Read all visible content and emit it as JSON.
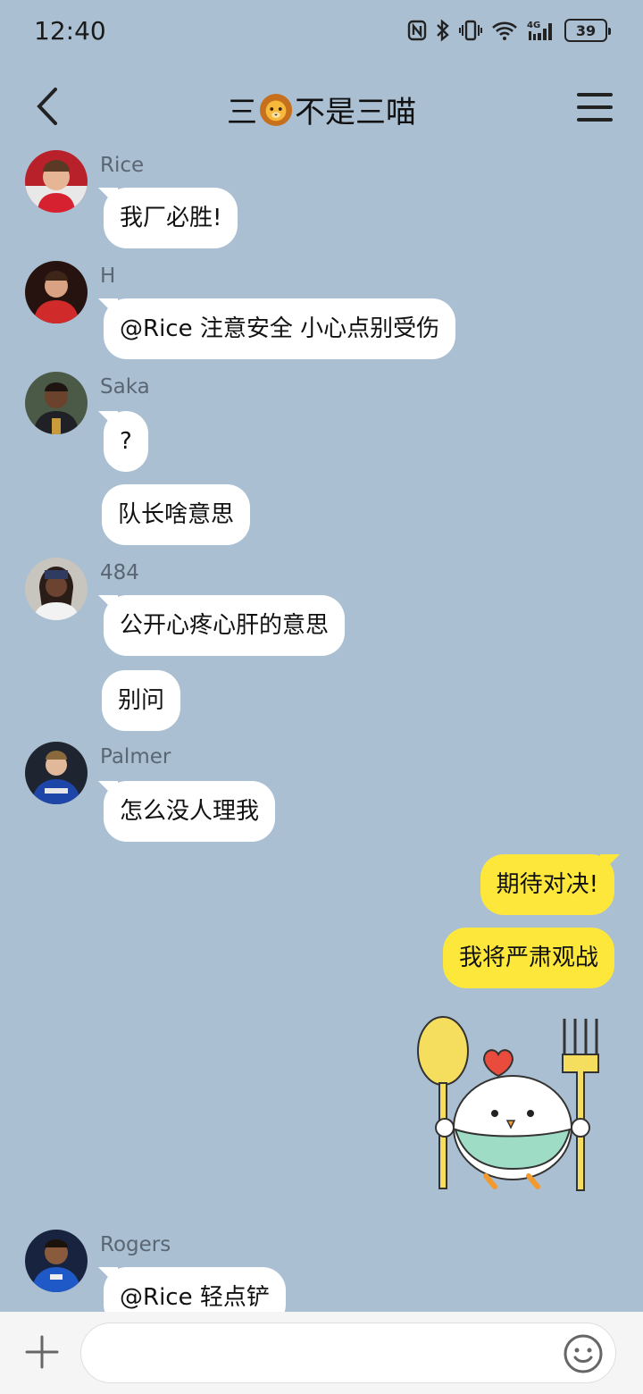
{
  "status_bar": {
    "time": "12:40",
    "battery": "39"
  },
  "header": {
    "title_prefix": "三",
    "title_suffix": "不是三喵"
  },
  "messages": [
    {
      "sender": "Rice",
      "bubbles": [
        "我厂必胜!"
      ]
    },
    {
      "sender": "H",
      "bubbles": [
        "@Rice 注意安全  小心点别受伤"
      ]
    },
    {
      "sender": "Saka",
      "bubbles": [
        "?",
        "队长啥意思"
      ]
    },
    {
      "sender": "484",
      "bubbles": [
        "公开心疼心肝的意思",
        "别问"
      ]
    },
    {
      "sender": "Palmer",
      "bubbles": [
        "怎么没人理我"
      ]
    },
    {
      "sender": "me",
      "bubbles": [
        "期待对决!",
        "我将严肃观战"
      ]
    },
    {
      "sender": "Rogers",
      "bubbles": [
        "@Rice 轻点铲"
      ]
    }
  ],
  "input": {
    "placeholder": ""
  },
  "colors": {
    "background": "#aabfd2",
    "my_bubble": "#fde73b",
    "other_bubble": "#ffffff"
  }
}
